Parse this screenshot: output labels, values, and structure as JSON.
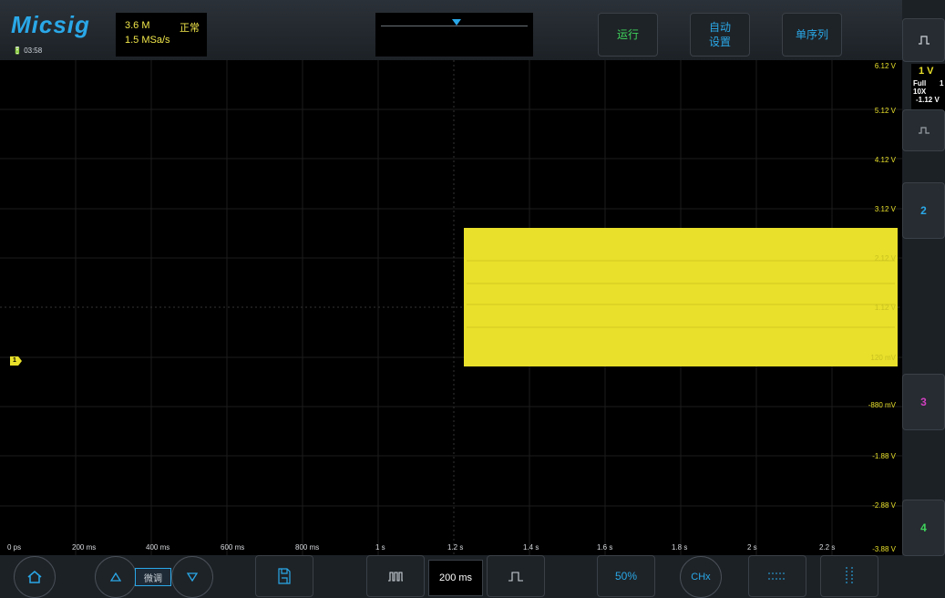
{
  "header": {
    "brand": "Micsig",
    "clock": "03:58",
    "memory_depth": "3.6 M",
    "acq_mode": "正常",
    "sample_rate": "1.5 MSa/s",
    "buttons": {
      "run": "运行",
      "auto_set_line1": "自动",
      "auto_set_line2": "设置",
      "single": "单序列"
    }
  },
  "channel1": {
    "scale": "1 V",
    "bandwidth": "Full",
    "bandwidth_right": "1",
    "probe": "10X",
    "offset": "-1.12 V",
    "marker": "1",
    "color": "#e8e02a"
  },
  "channels": {
    "ch2_label": "2",
    "ch3_label": "3",
    "ch4_label": "4",
    "ch2_color": "#2aa8e8",
    "ch3_color": "#d040c0",
    "ch4_color": "#3fd45c"
  },
  "vertical_labels": [
    "6.12 V",
    "5.12 V",
    "4.12 V",
    "3.12 V",
    "2.12 V",
    "1.12 V",
    "120 mV",
    "-880 mV",
    "-1.88 V",
    "-2.88 V",
    "-3.88 V"
  ],
  "time_labels": [
    "0 ps",
    "200 ms",
    "400 ms",
    "600 ms",
    "800 ms",
    "1 s",
    "1.2 s",
    "1.4 s",
    "1.6 s",
    "1.8 s",
    "2 s",
    "2.2 s"
  ],
  "bottom": {
    "fine_label": "微调",
    "timebase": "200 ms",
    "trigger_level": "50%",
    "channel_select": "CHx"
  }
}
